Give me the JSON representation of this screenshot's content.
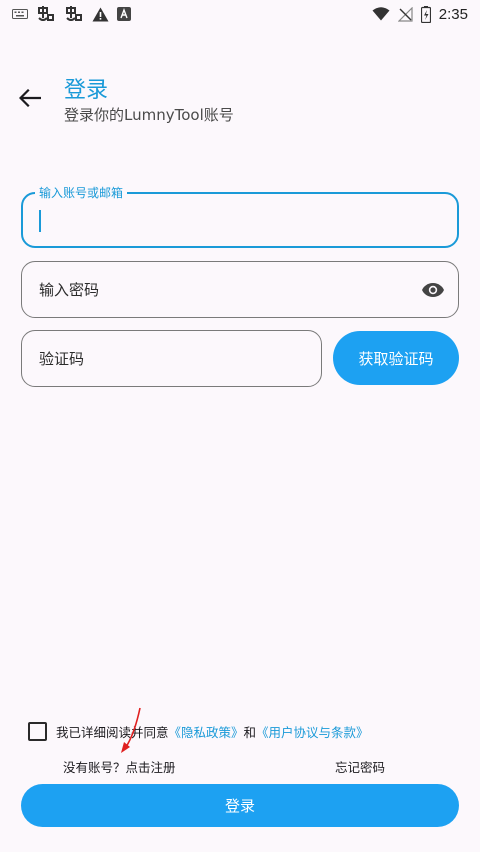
{
  "status_bar": {
    "time": "2:35",
    "left_icons": [
      "keyboard-icon",
      "app-notification-icon",
      "app-notification-icon",
      "warning-icon",
      "a-badge-icon"
    ],
    "right_icons": [
      "wifi-icon",
      "no-signal-icon",
      "battery-charging-icon"
    ]
  },
  "header": {
    "title": "登录",
    "subtitle": "登录你的LumnyTool账号"
  },
  "form": {
    "account_label": "输入账号或邮箱",
    "password_placeholder": "输入密码",
    "code_placeholder": "验证码",
    "get_code_label": "获取验证码"
  },
  "agreement": {
    "prefix": "我已详细阅读并同意",
    "privacy_link": "《隐私政策》",
    "and": "和",
    "terms_link": "《用户协议与条款》",
    "checked": false
  },
  "links": {
    "register": "没有账号？点击注册",
    "forgot": "忘记密码"
  },
  "login_button": "登录",
  "colors": {
    "accent": "#1da1f2",
    "title": "#1a9ad8",
    "background": "#fcf8fc",
    "annotation": "#e02020"
  }
}
